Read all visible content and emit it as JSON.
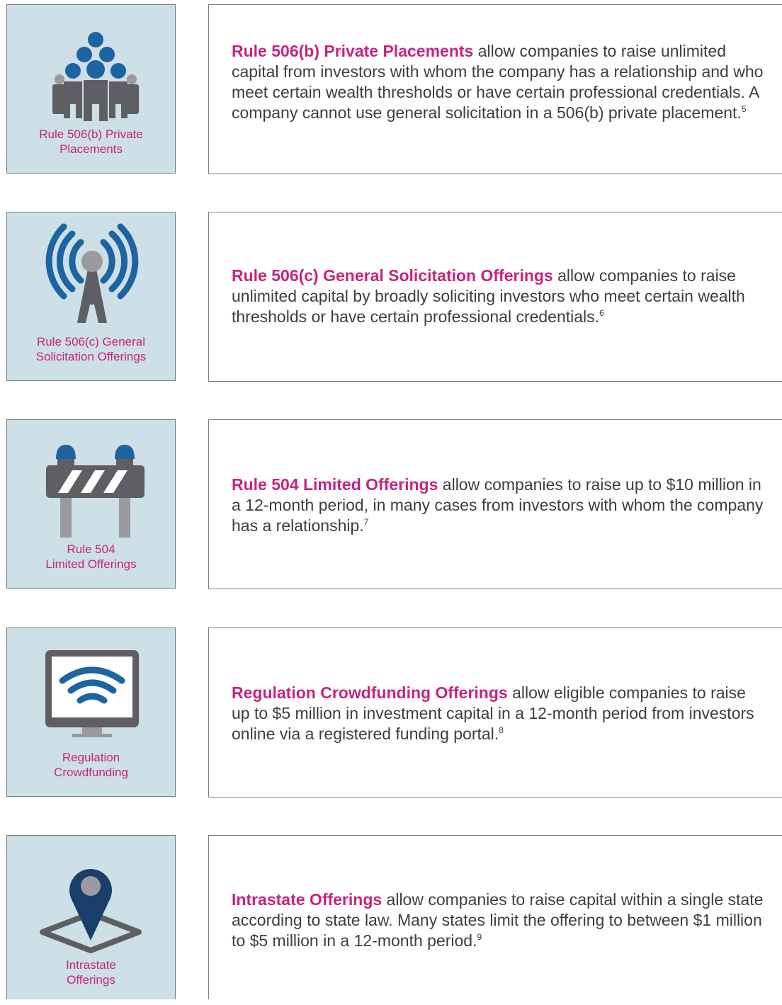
{
  "offerings": [
    {
      "icon": "investor-group-icon",
      "caption_line1": "Rule 506(b) Private",
      "caption_line2": "Placements",
      "lead": "Rule 506(b) Private Placements",
      "body": " allow companies to raise unlimited capital from investors with whom the company has a relationship and who meet certain wealth thresholds or have certain professional credentials. A company cannot use general solicitation in a 506(b) private placement.",
      "footnote": "5"
    },
    {
      "icon": "broadcast-tower-icon",
      "caption_line1": "Rule 506(c) General",
      "caption_line2": "Solicitation Offerings",
      "lead": "Rule 506(c) General Solicitation Offerings",
      "body": " allow companies to raise unlimited capital by broadly soliciting investors who meet certain wealth thresholds or have certain professional credentials.",
      "footnote": "6"
    },
    {
      "icon": "road-barrier-icon",
      "caption_line1": "Rule 504",
      "caption_line2": "Limited Offerings",
      "lead": "Rule 504 Limited Offerings",
      "body": " allow companies to raise up to $10 million in a 12-month period, in many cases from investors with whom the company has a relationship.",
      "footnote": "7"
    },
    {
      "icon": "monitor-wifi-icon",
      "caption_line1": "Regulation",
      "caption_line2": "Crowdfunding",
      "lead": "Regulation Crowdfunding Offerings",
      "body": " allow eligible companies to raise up to $5 million in investment capital in a 12-month period from investors online via a registered funding portal.",
      "footnote": "8"
    },
    {
      "icon": "map-pin-icon",
      "caption_line1": "Intrastate",
      "caption_line2": "Offerings",
      "lead": "Intrastate Offerings",
      "body": " allow companies to raise capital within a single state according to state law. Many states limit the offering to between $1 million to $5 million in a 12-month period.",
      "footnote": "9"
    }
  ],
  "colors": {
    "accent": "#c8237f",
    "icon_blue": "#1e64a0",
    "icon_navy": "#193e6a",
    "icon_gray": "#5f5f63",
    "panel": "#cddfe7"
  }
}
